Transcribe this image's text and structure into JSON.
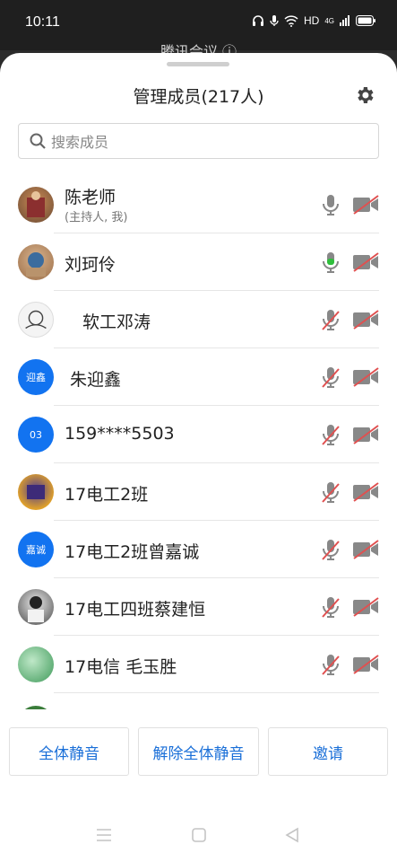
{
  "status_bar": {
    "time": "10:11",
    "network": "HD",
    "signal_label": "4G",
    "icons": [
      "headphones-icon",
      "mic-status-icon",
      "wifi-icon",
      "signal-icon",
      "battery-icon"
    ]
  },
  "background_screen": {
    "title": "腾讯会议"
  },
  "sheet": {
    "title": "管理成员(217人)",
    "search_placeholder": "搜索成员",
    "members": [
      {
        "name": "陈老师",
        "subtitle": "(主持人, 我)",
        "avatar": "photo",
        "mic": "on",
        "camera": "off"
      },
      {
        "name": "刘珂伶",
        "subtitle": "",
        "avatar": "photo",
        "mic": "speaking",
        "camera": "off"
      },
      {
        "name": "软工邓涛",
        "subtitle": "",
        "avatar": "photo",
        "mic": "off",
        "camera": "off"
      },
      {
        "name": "朱迎鑫",
        "subtitle": "",
        "avatar_text": "迎鑫",
        "mic": "off",
        "camera": "off"
      },
      {
        "name": "159****5503",
        "subtitle": "",
        "avatar_text": "03",
        "mic": "off",
        "camera": "off"
      },
      {
        "name": "17电工2班",
        "subtitle": "",
        "avatar": "photo",
        "mic": "off",
        "camera": "off"
      },
      {
        "name": "17电工2班曾嘉诚",
        "subtitle": "",
        "avatar_text": "嘉诚",
        "mic": "off",
        "camera": "off"
      },
      {
        "name": "17电工四班蔡建恒",
        "subtitle": "",
        "avatar": "photo",
        "mic": "off",
        "camera": "off"
      },
      {
        "name": "17电信 毛玉胜",
        "subtitle": "",
        "avatar": "photo",
        "mic": "off",
        "camera": "off"
      }
    ],
    "actions": {
      "mute_all": "全体静音",
      "unmute_all": "解除全体静音",
      "invite": "邀请"
    }
  },
  "colors": {
    "accent": "#1a6fd8",
    "avatar_blue": "#1273f0",
    "muted_red": "#e05050",
    "speaking_green": "#2fbf3c"
  }
}
